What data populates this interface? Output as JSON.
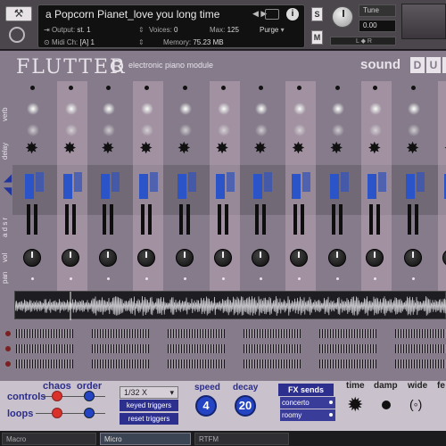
{
  "header": {
    "instrument_name": "a Popcorn Pianet_love you long time",
    "output_label": "Output:",
    "output_value": "st. 1",
    "voices_label": "Voices:",
    "voices_value": "0",
    "max_label": "Max:",
    "max_value": "125",
    "purge_label": "Purge",
    "midi_label": "Midi Ch:",
    "midi_value": "[A]  1",
    "memory_label": "Memory:",
    "memory_value": "75.23 MB",
    "s_label": "S",
    "m_label": "M",
    "tune_label": "Tune",
    "tune_value": "0.00",
    "lr_label": "L ◆ R"
  },
  "main": {
    "title": "FLUTTER",
    "subtitle": "electronic piano module",
    "brand": "sound",
    "brand_letters": [
      "D",
      "U",
      "S"
    ],
    "row_labels": {
      "verb": "verb",
      "delay": "delay",
      "adsr": "a d s r",
      "vol": "vol",
      "pan": "pan"
    },
    "column_count": 12
  },
  "controls": {
    "chaos_label": "chaos",
    "order_label": "order",
    "controls_label": "controls",
    "loops_label": "loops",
    "rate_select": "1/32 X",
    "keyed_triggers": "keyed triggers",
    "reset_triggers": "reset triggers",
    "speed_label": "speed",
    "speed_value": "4",
    "decay_label": "decay",
    "decay_value": "20",
    "fx_title": "FX sends",
    "fx_items": [
      "concerto",
      "roomy"
    ],
    "time_label": "time",
    "damp_label": "damp",
    "wide_label": "wide",
    "fe_label": "fe"
  },
  "tabs": [
    "Macro",
    "Micro",
    "RTFM"
  ],
  "colors": {
    "panel": "#857b8b",
    "accent_blue": "#2544c4",
    "accent_red": "#d8322a",
    "label_blue": "#2b2d8a"
  }
}
